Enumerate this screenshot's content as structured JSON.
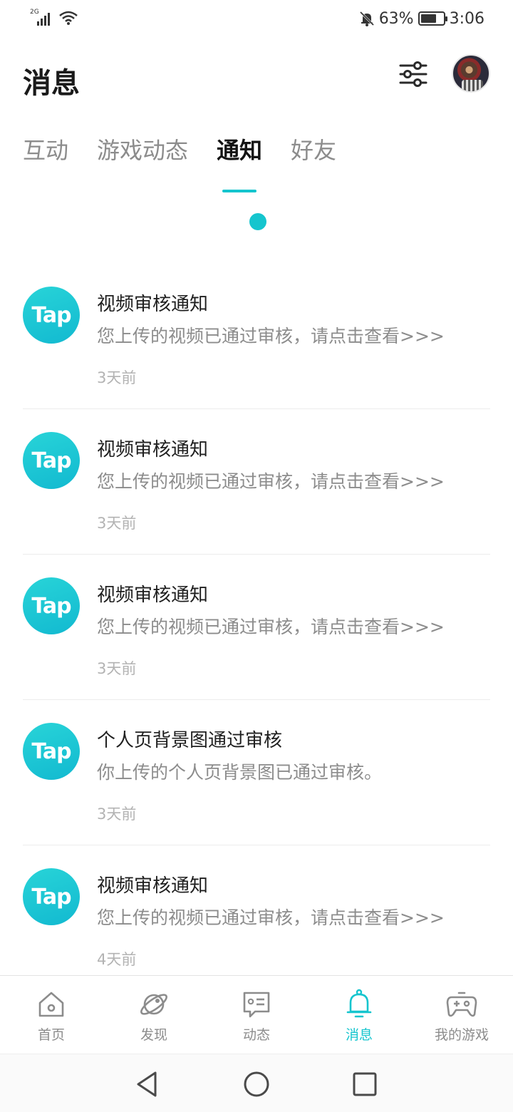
{
  "status_bar": {
    "network": "2G",
    "battery": "63%",
    "battery_level": 0.63,
    "time": "3:06",
    "icons": [
      "signal-icon",
      "wifi-icon",
      "mute-bell-icon",
      "battery-icon"
    ]
  },
  "header": {
    "title": "消息",
    "filter_icon": "filter-sliders-icon",
    "avatar": "user-avatar"
  },
  "tabs": [
    {
      "label": "互动",
      "active": false
    },
    {
      "label": "游戏动态",
      "active": false
    },
    {
      "label": "通知",
      "active": true
    },
    {
      "label": "好友",
      "active": false
    }
  ],
  "notifications": [
    {
      "logo": "Tap",
      "title": "视频审核通知",
      "body": "您上传的视频已通过审核，请点击查看>>>",
      "time": "3天前"
    },
    {
      "logo": "Tap",
      "title": "视频审核通知",
      "body": "您上传的视频已通过审核，请点击查看>>>",
      "time": "3天前"
    },
    {
      "logo": "Tap",
      "title": "视频审核通知",
      "body": "您上传的视频已通过审核，请点击查看>>>",
      "time": "3天前"
    },
    {
      "logo": "Tap",
      "title": "个人页背景图通过审核",
      "body": "你上传的个人页背景图已通过审核。",
      "time": "3天前"
    },
    {
      "logo": "Tap",
      "title": "视频审核通知",
      "body": "您上传的视频已通过审核，请点击查看>>>",
      "time": "4天前"
    }
  ],
  "bottom_nav": [
    {
      "label": "首页",
      "icon": "home-icon",
      "active": false
    },
    {
      "label": "发现",
      "icon": "planet-icon",
      "active": false
    },
    {
      "label": "动态",
      "icon": "chat-card-icon",
      "active": false
    },
    {
      "label": "消息",
      "icon": "bell-icon",
      "active": true
    },
    {
      "label": "我的游戏",
      "icon": "gamepad-icon",
      "active": false
    }
  ],
  "colors": {
    "accent": "#15c5ce",
    "text_primary": "#1f1f1f",
    "text_secondary": "#8c8c8c",
    "text_muted": "#b3b3b3"
  }
}
